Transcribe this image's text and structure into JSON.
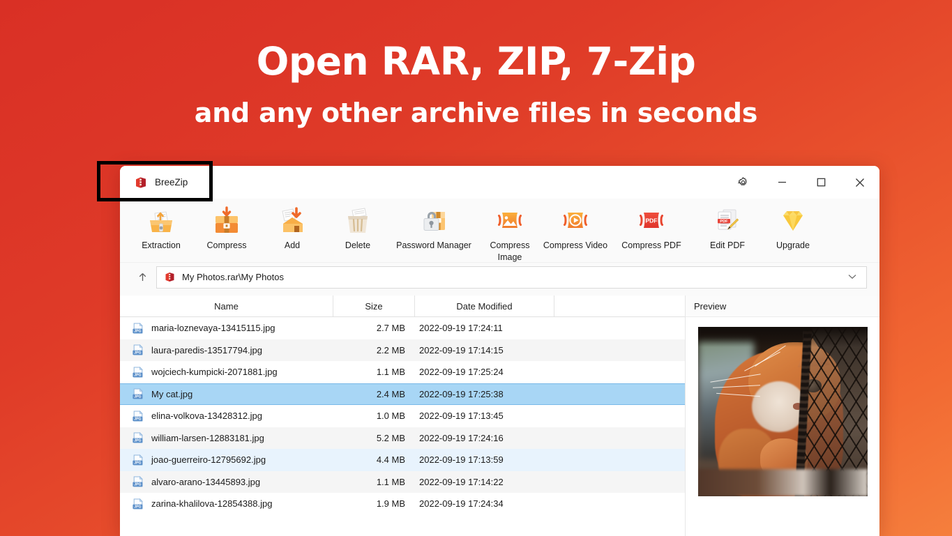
{
  "promo": {
    "title": "Open RAR, ZIP, 7-Zip",
    "subtitle": "and any other archive files in seconds",
    "bg_start": "#d93025",
    "bg_end": "#f57f3d"
  },
  "window": {
    "app_name": "BreeZip",
    "logo_icon": "breezip-logo-icon",
    "controls": [
      {
        "name": "settings-button",
        "icon": "gear-icon",
        "label": "Settings"
      },
      {
        "name": "minimize-button",
        "icon": "minimize-icon",
        "label": "Minimize"
      },
      {
        "name": "maximize-button",
        "icon": "maximize-icon",
        "label": "Maximize"
      },
      {
        "name": "close-button",
        "icon": "close-icon",
        "label": "Close"
      }
    ]
  },
  "toolbar": {
    "items": [
      {
        "label": "Extraction",
        "icon": "extraction-icon",
        "wide": false
      },
      {
        "label": "Compress",
        "icon": "compress-box-icon",
        "wide": false
      },
      {
        "label": "Add",
        "icon": "add-to-archive-icon",
        "wide": false
      },
      {
        "label": "Delete",
        "icon": "delete-trash-icon",
        "wide": false
      },
      {
        "label": "Password Manager",
        "icon": "password-lock-icon",
        "wide": true
      },
      {
        "label": "Compress Image",
        "icon": "compress-image-icon",
        "wide": false
      },
      {
        "label": "Compress Video",
        "icon": "compress-video-icon",
        "wide": false
      },
      {
        "label": "Compress PDF",
        "icon": "compress-pdf-icon",
        "wide": true
      },
      {
        "label": "Edit PDF",
        "icon": "edit-pdf-icon",
        "wide": false
      },
      {
        "label": "Upgrade",
        "icon": "upgrade-diamond-icon",
        "wide": false
      }
    ]
  },
  "address": {
    "up_icon": "arrow-up-icon",
    "archive_icon": "rar-archive-icon",
    "path": "My Photos.rar\\My Photos",
    "dropdown_icon": "chevron-down-icon"
  },
  "filelist": {
    "columns": [
      "Name",
      "Size",
      "Date Modified",
      ""
    ],
    "rows": [
      {
        "name": "maria-loznevaya-13415115.jpg",
        "size": "2.7 MB",
        "date": "2022-09-19 17:24:11",
        "style": "plain"
      },
      {
        "name": "laura-paredis-13517794.jpg",
        "size": "2.2 MB",
        "date": "2022-09-19 17:14:15",
        "style": "alt"
      },
      {
        "name": "wojciech-kumpicki-2071881.jpg",
        "size": "1.1 MB",
        "date": "2022-09-19 17:25:24",
        "style": "plain"
      },
      {
        "name": "My cat.jpg",
        "size": "2.4 MB",
        "date": "2022-09-19 17:25:38",
        "style": "sel"
      },
      {
        "name": "elina-volkova-13428312.jpg",
        "size": "1.0 MB",
        "date": "2022-09-19 17:13:45",
        "style": "plain"
      },
      {
        "name": "william-larsen-12883181.jpg",
        "size": "5.2 MB",
        "date": "2022-09-19 17:24:16",
        "style": "alt"
      },
      {
        "name": "joao-guerreiro-12795692.jpg",
        "size": "4.4 MB",
        "date": "2022-09-19 17:13:59",
        "style": "tint"
      },
      {
        "name": "alvaro-arano-13445893.jpg",
        "size": "1.1 MB",
        "date": "2022-09-19 17:14:22",
        "style": "alt"
      },
      {
        "name": "zarina-khalilova-12854388.jpg",
        "size": "1.9 MB",
        "date": "2022-09-19 17:24:34",
        "style": "plain"
      }
    ],
    "row_icon": "jpg-file-icon",
    "selected_row_index": 3
  },
  "preview": {
    "title": "Preview",
    "image_alt": "orange-cat-photo"
  }
}
